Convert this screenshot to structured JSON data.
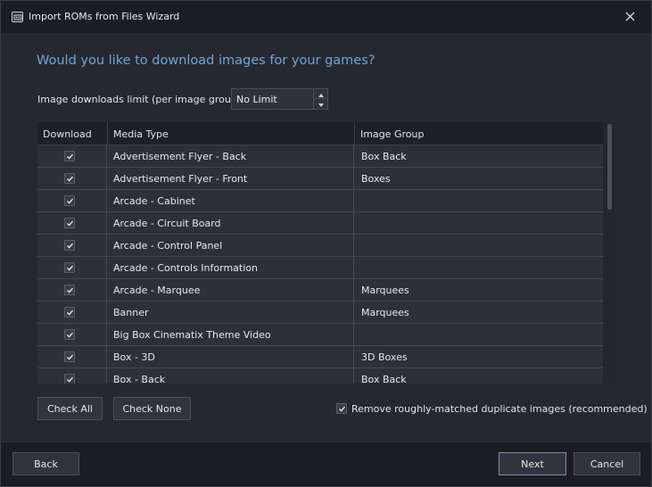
{
  "window": {
    "title": "Import ROMs from Files Wizard",
    "icon": "wizard-app-icon",
    "close_icon": "close-icon"
  },
  "page": {
    "heading": "Would you like to download images for your games?",
    "limit_label": "Image downloads limit (per image group):",
    "limit_value": "No Limit"
  },
  "table": {
    "columns": [
      "Download",
      "Media Type",
      "Image Group"
    ],
    "rows": [
      {
        "checked": true,
        "media": "Advertisement Flyer - Back",
        "group": "Box Back"
      },
      {
        "checked": true,
        "media": "Advertisement Flyer - Front",
        "group": "Boxes"
      },
      {
        "checked": true,
        "media": "Arcade - Cabinet",
        "group": ""
      },
      {
        "checked": true,
        "media": "Arcade - Circuit Board",
        "group": ""
      },
      {
        "checked": true,
        "media": "Arcade - Control Panel",
        "group": ""
      },
      {
        "checked": true,
        "media": "Arcade - Controls Information",
        "group": ""
      },
      {
        "checked": true,
        "media": "Arcade - Marquee",
        "group": "Marquees"
      },
      {
        "checked": true,
        "media": "Banner",
        "group": "Marquees"
      },
      {
        "checked": true,
        "media": "Big Box Cinematix Theme Video",
        "group": ""
      },
      {
        "checked": true,
        "media": "Box - 3D",
        "group": "3D Boxes"
      },
      {
        "checked": true,
        "media": "Box - Back",
        "group": "Box Back"
      }
    ]
  },
  "buttons": {
    "check_all": "Check All",
    "check_none": "Check None",
    "back": "Back",
    "next": "Next",
    "cancel": "Cancel"
  },
  "options": {
    "remove_duplicates_label": "Remove roughly-matched duplicate images (recommended)",
    "remove_duplicates_checked": true
  },
  "colors": {
    "accent_heading": "#6ea6da",
    "background": "#262830",
    "titlebar": "#1c1d22"
  }
}
